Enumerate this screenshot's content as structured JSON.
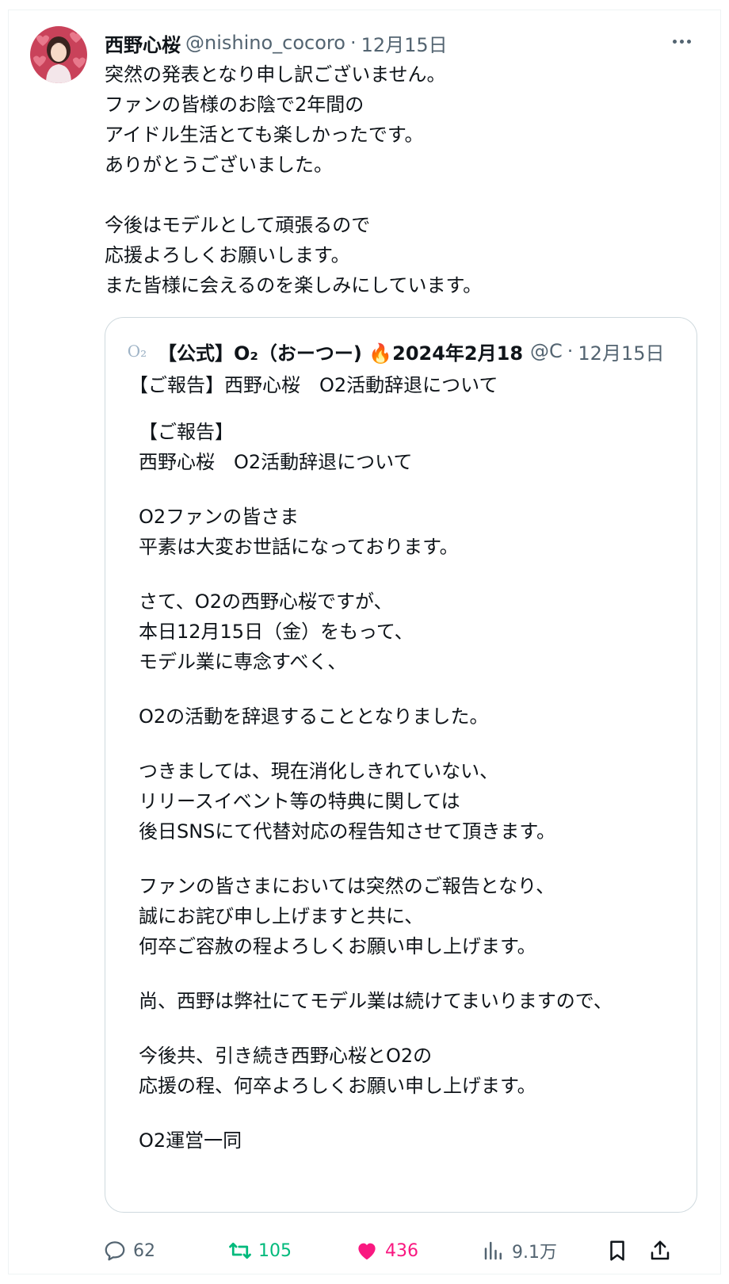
{
  "tweet": {
    "author_name": "西野心桜",
    "handle": "@nishino_cocoro",
    "separator": "·",
    "date": "12月15日",
    "lines": [
      "突然の発表となり申し訳ございません。",
      "ファンの皆様のお陰で2年間の",
      "アイドル生活とても楽しかったです。",
      "ありがとうございました。",
      "",
      "今後はモデルとして頑張るので",
      "応援よろしくお願いします。",
      "また皆様に会えるのを楽しみにしています。"
    ]
  },
  "quote": {
    "logo_text": "O₂",
    "author_name": "【公式】O₂（おーつー) 🔥2024年2月18",
    "handle": "@C",
    "separator": "·",
    "date": "12月15日",
    "title": "【ご報告】西野心桜　O2活動辞退について",
    "body_lines": [
      "【ご報告】",
      "西野心桜　O2活動辞退について",
      "",
      "O2ファンの皆さま",
      "平素は大変お世話になっております。",
      "",
      "さて、O2の西野心桜ですが、",
      "本日12月15日（金）をもって、",
      "モデル業に専念すべく、",
      "",
      "O2の活動を辞退することとなりました。",
      "",
      "つきましては、現在消化しきれていない、",
      "リリースイベント等の特典に関しては",
      "後日SNSにて代替対応の程告知させて頂きます。",
      "",
      "ファンの皆さまにおいては突然のご報告となり、",
      "誠にお詫び申し上げますと共に、",
      "何卒ご容赦の程よろしくお願い申し上げます。",
      "",
      "尚、西野は弊社にてモデル業は続けてまいりますので、",
      "",
      "今後共、引き続き西野心桜とO2の",
      "応援の程、何卒よろしくお願い申し上げます。",
      "",
      "O2運営一同"
    ]
  },
  "actions": {
    "replies": "62",
    "retweets": "105",
    "likes": "436",
    "views": "9.1万"
  },
  "colors": {
    "text": "#0f1419",
    "secondary": "#536471",
    "retweet": "#00ba7c",
    "like": "#f91880",
    "border": "#cfd9de"
  },
  "icons": [
    "more-icon",
    "reply-icon",
    "retweet-icon",
    "heart-icon",
    "views-icon",
    "bookmark-icon",
    "share-icon",
    "fire-icon"
  ]
}
